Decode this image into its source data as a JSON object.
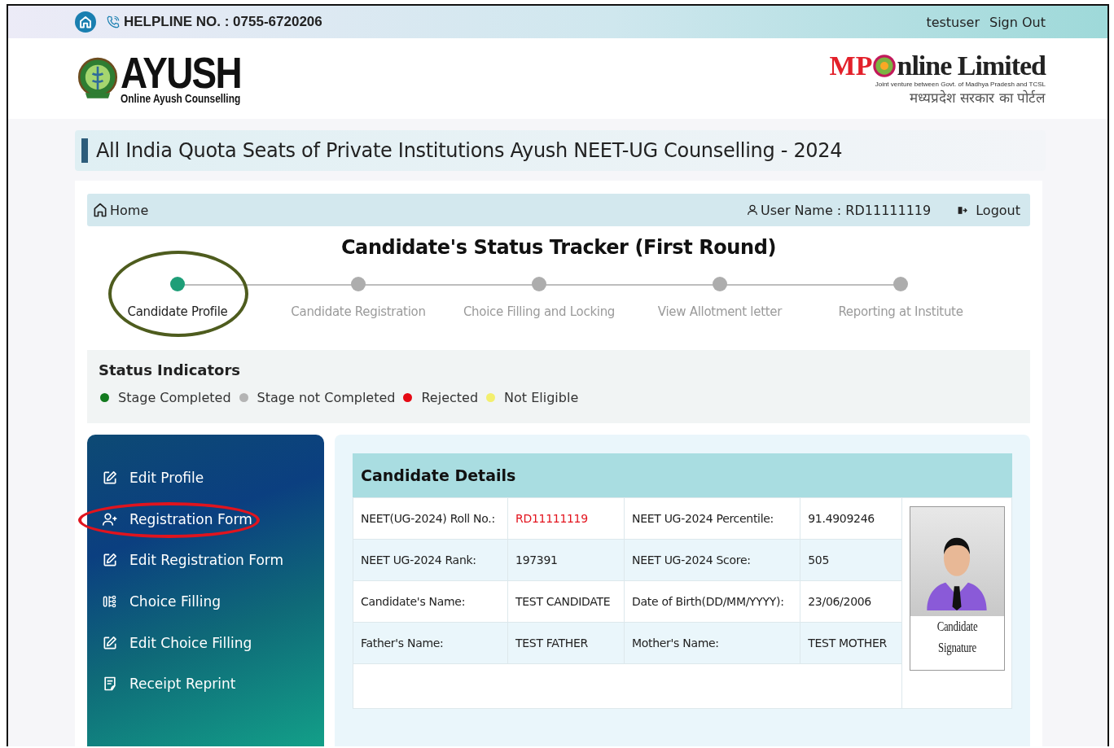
{
  "top_bar": {
    "helpline": "HELPLINE NO. : 0755-6720206",
    "username": "testuser",
    "sign_out": "Sign Out"
  },
  "header": {
    "logo_title": "AYUSH",
    "logo_subtitle": "Online Ayush Counselling",
    "partner_left": "MP",
    "partner_right": "nline Limited",
    "partner_tagline": "Joint venture between Govt. of Madhya Pradesh and TCSL",
    "partner_hindi": "मध्यप्रदेश सरकार का पोर्टल"
  },
  "page_title": "All India Quota Seats of Private Institutions Ayush NEET-UG Counselling - 2024",
  "nav": {
    "home": "Home",
    "user_name": "User Name : RD11111119",
    "logout": "Logout"
  },
  "tracker": {
    "title": "Candidate's Status Tracker (First Round)",
    "steps": [
      {
        "label": "Candidate Profile",
        "completed": true,
        "circled": true
      },
      {
        "label": "Candidate Registration",
        "completed": false,
        "circled": false
      },
      {
        "label": "Choice Filling and Locking",
        "completed": false,
        "circled": false
      },
      {
        "label": "View Allotment letter",
        "completed": false,
        "circled": false
      },
      {
        "label": "Reporting at Institute",
        "completed": false,
        "circled": false
      }
    ]
  },
  "status_indicators": {
    "title": "Status Indicators",
    "items": [
      {
        "label": "Stage Completed",
        "color": "#137a1f"
      },
      {
        "label": "Stage not Completed",
        "color": "#b4b4b4"
      },
      {
        "label": "Rejected",
        "color": "#e50914"
      },
      {
        "label": "Not Eligible",
        "color": "#f3ef6e"
      }
    ]
  },
  "sidebar": {
    "items": [
      {
        "label": "Edit Profile",
        "kind": "edit",
        "circled": false
      },
      {
        "label": "Registration Form",
        "kind": "register",
        "circled": true
      },
      {
        "label": "Edit Registration Form",
        "kind": "edit",
        "circled": false
      },
      {
        "label": "Choice Filling",
        "kind": "choices",
        "circled": false
      },
      {
        "label": "Edit Choice Filling",
        "kind": "edit",
        "circled": false
      },
      {
        "label": "Receipt Reprint",
        "kind": "receipt",
        "circled": false
      }
    ]
  },
  "details": {
    "title": "Candidate Details",
    "photo_caption": "Candidate Signature",
    "rows": [
      [
        {
          "label": "NEET(UG-2024) Roll No.:",
          "value": "RD11111119",
          "alert": true
        },
        {
          "label": "NEET UG-2024 Percentile:",
          "value": "91.4909246",
          "alert": false
        }
      ],
      [
        {
          "label": "NEET UG-2024 Rank:",
          "value": "197391",
          "alert": false
        },
        {
          "label": "NEET UG-2024 Score:",
          "value": "505",
          "alert": false
        }
      ],
      [
        {
          "label": "Candidate's Name:",
          "value": "TEST CANDIDATE",
          "alert": false
        },
        {
          "label": "Date of Birth(DD/MM/YYYY):",
          "value": "23/06/2006",
          "alert": false
        }
      ],
      [
        {
          "label": "Father's Name:",
          "value": "TEST FATHER",
          "alert": false
        },
        {
          "label": "Mother's Name:",
          "value": "TEST MOTHER",
          "alert": false
        }
      ]
    ]
  }
}
